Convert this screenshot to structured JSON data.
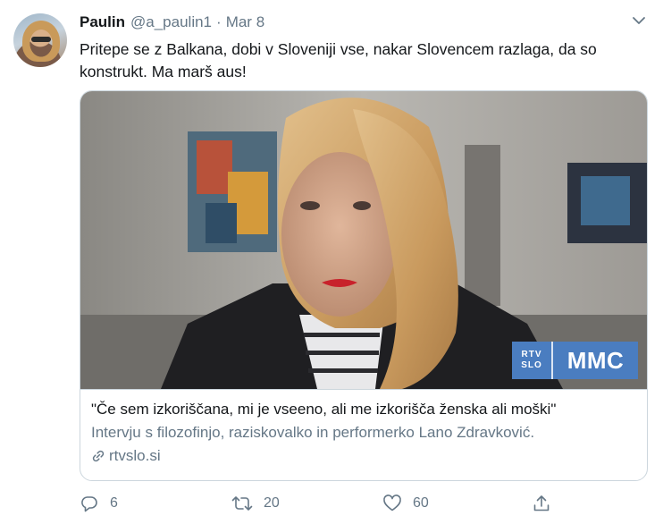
{
  "tweet": {
    "author_name": "Paulin",
    "author_handle": "@a_paulin1",
    "separator": "·",
    "date": "Mar 8",
    "text_line1": "Pritepe se z Balkana, dobi v Sloveniji vse, nakar Slovencem razlaga, da so",
    "text_line2": "konstrukt. Ma marš aus!"
  },
  "card": {
    "badge_left_line1": "RTV",
    "badge_left_line2": "SLO",
    "badge_right": "MMC",
    "title": "\"Če sem izkoriščana, mi je vseeno, ali me izkorišča ženska ali moški\"",
    "description": "Intervju s filozofinjo, raziskovalko in performerko Lano Zdravković.",
    "domain": "rtvslo.si"
  },
  "actions": {
    "reply_count": "6",
    "retweet_count": "20",
    "like_count": "60"
  },
  "icons": {
    "caret": "chevron-down-icon",
    "reply": "reply-icon",
    "retweet": "retweet-icon",
    "like": "heart-icon",
    "share": "share-icon",
    "link": "link-icon"
  },
  "colors": {
    "text": "#14171a",
    "secondary": "#657786",
    "border": "#ccd6dd",
    "badge": "#4a7dc0"
  }
}
